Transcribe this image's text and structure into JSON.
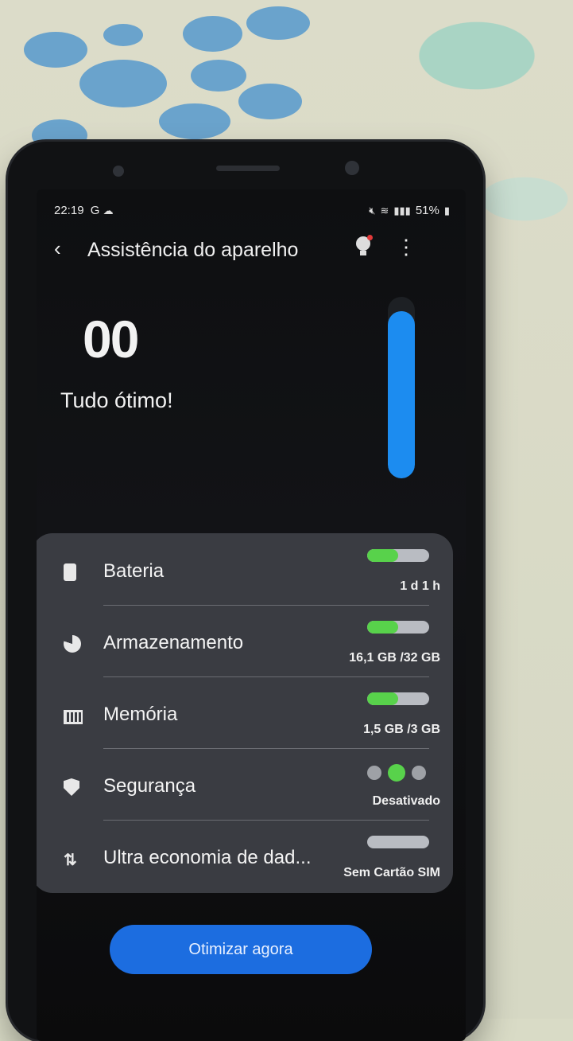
{
  "status_bar": {
    "time": "22:19",
    "carrier_indicator": "G",
    "battery_percent": "51%",
    "icons": [
      "cloud-icon",
      "mute-icon",
      "wifi-icon",
      "signal-icon",
      "battery-icon"
    ]
  },
  "header": {
    "title": "Assistência do aparelho",
    "back_icon": "‹",
    "more_icon": "⋮"
  },
  "overview": {
    "score_visible": "00",
    "status_text": "Tudo ótimo!",
    "gauge_level": 0.92,
    "accent_color": "#1c8cf0"
  },
  "items": [
    {
      "label": "Bateria",
      "value": "1 d 1 h",
      "icon": "battery-icon",
      "indicator": "bar",
      "level": 0.5
    },
    {
      "label": "Armazenamento",
      "value": "16,1 GB /32 GB",
      "icon": "storage-pie-icon",
      "indicator": "bar",
      "level": 0.5
    },
    {
      "label": "Memória",
      "value": "1,5 GB /3 GB",
      "icon": "memory-chip-icon",
      "indicator": "bar",
      "level": 0.5
    },
    {
      "label": "Segurança",
      "value": "Desativado",
      "icon": "shield-icon",
      "indicator": "dots",
      "active_dot": 1
    },
    {
      "label": "Ultra economia de dad...",
      "value": "Sem Cartão SIM",
      "icon": "data-saver-icon",
      "indicator": "bar",
      "level": 0
    }
  ],
  "colors": {
    "good": "#58d24b",
    "card": "#3a3c42",
    "button": "#1c6de0"
  },
  "optimize_button": "Otimizar agora"
}
